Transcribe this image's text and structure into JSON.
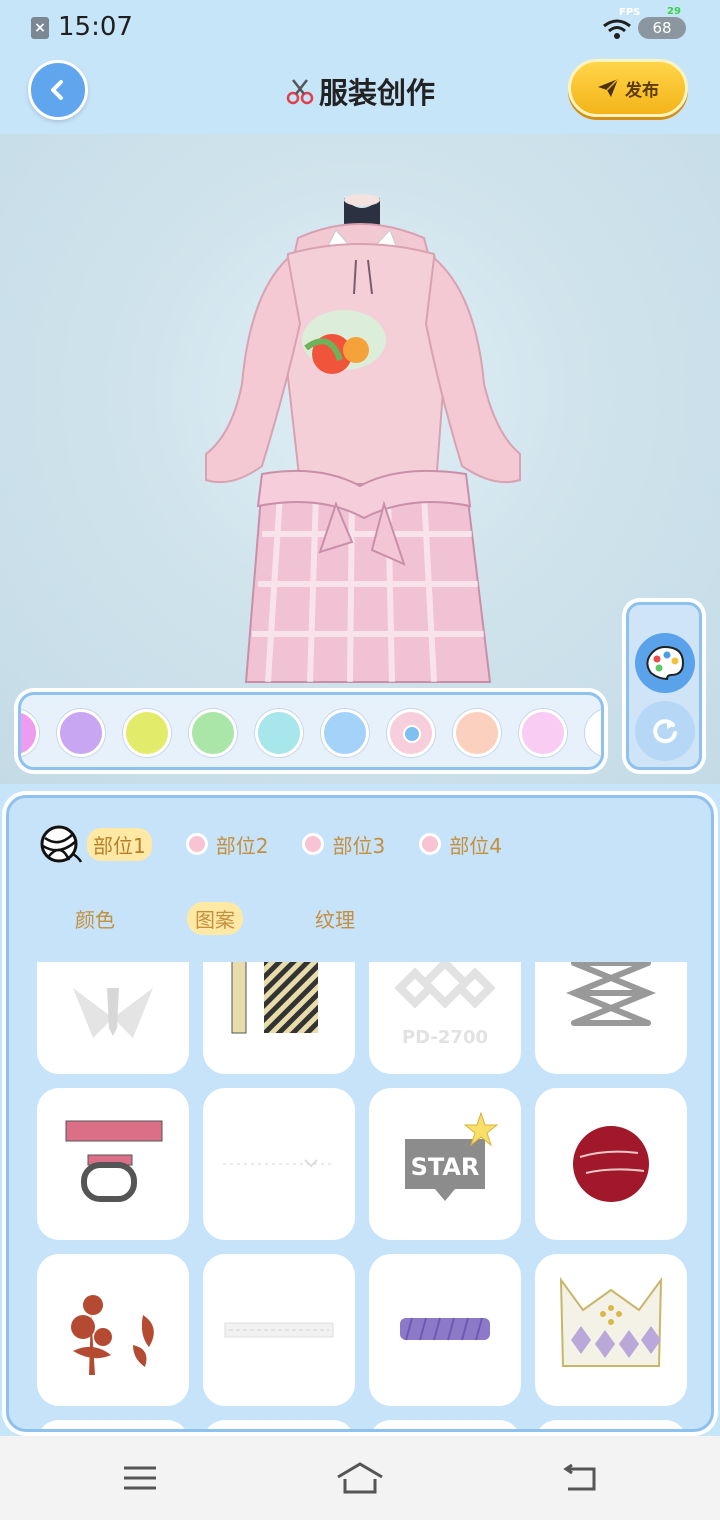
{
  "status_bar": {
    "time": "15:07",
    "fps_label": "FPS",
    "fps_value": "29",
    "battery": "68"
  },
  "header": {
    "title": "服装创作",
    "publish_label": "发布",
    "back_icon": "chevron-left-icon",
    "title_icon": "scissors-icon",
    "publish_icon": "paper-plane-icon"
  },
  "palette": {
    "colors": [
      "#ee9cef",
      "#c9a6f2",
      "#e3ec6a",
      "#a9e6a8",
      "#a7e6ea",
      "#a5d2f8",
      "#f7cfdc",
      "#fbd0bf",
      "#f9ccf3"
    ],
    "selected_index": 6
  },
  "side_tools": [
    "palette-icon",
    "refresh-icon"
  ],
  "parts": {
    "tabs": [
      "部位1",
      "部位2",
      "部位3",
      "部位4"
    ],
    "active_index": 0
  },
  "sub_tabs": {
    "tabs": [
      "颜色",
      "图案",
      "纹理"
    ],
    "active_index": 1
  },
  "patterns": {
    "items": [
      {
        "name": "tie-collar-pattern"
      },
      {
        "name": "striped-tape-pattern"
      },
      {
        "name": "logo-pattern",
        "text": "PD-2700"
      },
      {
        "name": "lace-up-pattern"
      },
      {
        "name": "buckle-strap-pattern"
      },
      {
        "name": "dotted-line-pattern"
      },
      {
        "name": "star-badge-pattern",
        "text": "STAR"
      },
      {
        "name": "red-sphere-pattern"
      },
      {
        "name": "red-flowers-pattern"
      },
      {
        "name": "thin-band-pattern"
      },
      {
        "name": "purple-band-pattern"
      },
      {
        "name": "crown-pattern"
      }
    ]
  },
  "nav": [
    "menu-icon",
    "home-icon",
    "back-icon"
  ]
}
